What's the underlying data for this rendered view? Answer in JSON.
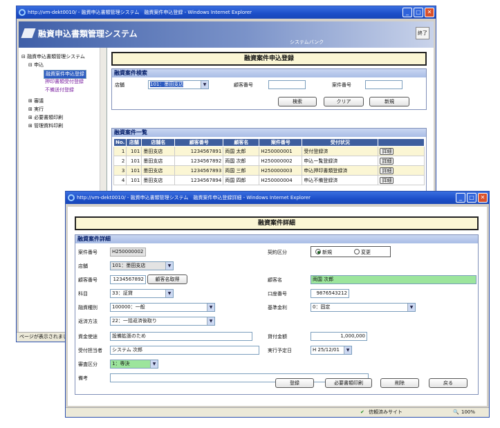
{
  "back_window": {
    "title": "http://vm-dekt0010/ - 融資申込書類管理システム　融資案件申込登録 - Windows Internet Explorer",
    "app_name": "融資申込書類管理システム",
    "bank_label": "システムバンク",
    "exit_label": "終了",
    "tree": {
      "root": "融資申込書類管理システム",
      "group1": "申込",
      "item_selected": "融資案件申込登録",
      "item2": "押印書類受付登録",
      "item3": "不備送付登録",
      "group2": "審議",
      "group3": "実行",
      "group4": "必要書類印刷",
      "group5": "管理資料印刷"
    },
    "page_title": "融資案件申込登録",
    "search_panel": {
      "title": "融資案件検索",
      "branch_label": "店舗",
      "branch_value": "101：墨田支店",
      "customer_label": "顧客番号",
      "case_label": "案件番号",
      "search_btn": "検索",
      "clear_btn": "クリア",
      "new_btn": "新規"
    },
    "list_panel": {
      "title": "融資案件一覧",
      "columns": [
        "No.",
        "店舗",
        "店舗名",
        "顧客番号",
        "顧客名",
        "案件番号",
        "受付状況",
        ""
      ],
      "rows": [
        {
          "no": "1",
          "branch": "101",
          "branch_name": "墨田支店",
          "customer_no": "1234567891",
          "customer_name": "両国 太郎",
          "case_no": "H250000001",
          "status": "受付登録済",
          "action": "詳細"
        },
        {
          "no": "2",
          "branch": "101",
          "branch_name": "墨田支店",
          "customer_no": "1234567892",
          "customer_name": "両国 次郎",
          "case_no": "H250000002",
          "status": "申込ー覧登録済",
          "action": "詳細"
        },
        {
          "no": "3",
          "branch": "101",
          "branch_name": "墨田支店",
          "customer_no": "1234567893",
          "customer_name": "両国 三郎",
          "case_no": "H250000003",
          "status": "申込押印書類登録済",
          "action": "詳細"
        },
        {
          "no": "4",
          "branch": "101",
          "branch_name": "墨田支店",
          "customer_no": "1234567894",
          "customer_name": "両国 四郎",
          "case_no": "H250000004",
          "status": "申込不備登録済",
          "action": "詳細"
        }
      ]
    },
    "status_text": "ページが表示されました"
  },
  "front_window": {
    "title": "http://vm-dekt0010/ - 融資申込書類管理システム　融資案件申込登録詳細 - Windows Internet Explorer",
    "page_title": "融資案件詳細",
    "panel_title": "融資案件詳細",
    "fields": {
      "case_no_label": "案件番号",
      "case_no_value": "H250000002",
      "contract_label": "契約区分",
      "radio_new": "新規",
      "radio_change": "変更",
      "branch_label": "店舗",
      "branch_value": "101：墨田支店",
      "customer_no_label": "顧客番号",
      "customer_no_value": "1234567892",
      "get_name_btn": "顧客名取得",
      "customer_name_label": "顧客名",
      "customer_name_value": "両国 次郎",
      "subject_label": "科目",
      "subject_value": "33：証貸",
      "account_label": "口座番号",
      "account_value": "9876543212",
      "loan_type_label": "融資種別",
      "loan_type_value": "100000：一般",
      "base_rate_label": "基準金利",
      "base_rate_value": "0：固定",
      "repay_label": "返済方法",
      "repay_value": "22：一括返済後取り",
      "purpose_label": "資金使途",
      "purpose_value": "設備拡張のため",
      "amount_label": "貸付金額",
      "amount_value": "1,000,000",
      "staff_label": "受付担当者",
      "staff_value": "システム 次郎",
      "exec_date_label": "実行予定日",
      "exec_date_value": "H 25/12/01",
      "review_label": "審査区分",
      "review_value": "1：専決",
      "remarks_label": "備考",
      "remarks_value": ""
    },
    "buttons": {
      "register": "登録",
      "print": "必要書類印刷",
      "delete": "削除",
      "back": "戻る"
    },
    "status": {
      "trusted": "信頼済みサイト",
      "zoom": "100%"
    }
  }
}
